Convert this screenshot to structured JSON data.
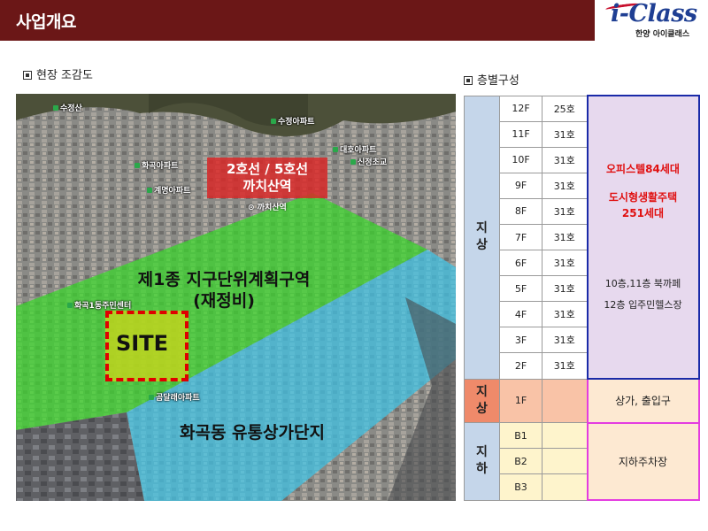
{
  "header": {
    "title": "사업개요",
    "logo_text": "i-Class",
    "logo_sub": "한양 아이클래스"
  },
  "sections": {
    "left": "현장 조감도",
    "right": "층별구성"
  },
  "aerial": {
    "station_line1": "2호선 / 5호선",
    "station_line2": "까치산역",
    "station_pin": "⊙ 까치산역",
    "zone_line1": "제1종 지구단위계획구역",
    "zone_line2": "(재정비)",
    "site": "SITE",
    "district": "화곡동 유통상가단지",
    "map_labels": [
      "수정산",
      "수정아파트",
      "대호아파트",
      "화곡아파트",
      "신정초교",
      "계명아파트",
      "까치산역",
      "화곡1동주민센터",
      "곰달래아파트"
    ]
  },
  "floors": {
    "above_group": "지\n상",
    "commercial_group": "지\n상",
    "below_group": "지\n하",
    "rows": [
      {
        "floor": "12F",
        "units": "25호"
      },
      {
        "floor": "11F",
        "units": "31호"
      },
      {
        "floor": "10F",
        "units": "31호"
      },
      {
        "floor": "9F",
        "units": "31호"
      },
      {
        "floor": "8F",
        "units": "31호"
      },
      {
        "floor": "7F",
        "units": "31호"
      },
      {
        "floor": "6F",
        "units": "31호"
      },
      {
        "floor": "5F",
        "units": "31호"
      },
      {
        "floor": "4F",
        "units": "31호"
      },
      {
        "floor": "3F",
        "units": "31호"
      },
      {
        "floor": "2F",
        "units": "31호"
      }
    ],
    "commercial": {
      "floor": "1F",
      "units": "",
      "use": "상가, 출입구"
    },
    "basement": [
      {
        "floor": "B1",
        "units": ""
      },
      {
        "floor": "B2",
        "units": ""
      },
      {
        "floor": "B3",
        "units": ""
      }
    ],
    "basement_use": "지하주차장",
    "office_use": {
      "line1": "오피스텔84세대",
      "line2": "도시형생활주택",
      "line3": "251세대",
      "line4": "10층,11층 북까페",
      "line5": "12층 입주민헬스장"
    }
  },
  "colors": {
    "header_bg": "#6b1717",
    "zone_green": "#39d82a",
    "district_blue": "#3fc4e6",
    "site_border": "#e00000",
    "office_border": "#1a2aa8",
    "commercial_border": "#e43ce0"
  }
}
